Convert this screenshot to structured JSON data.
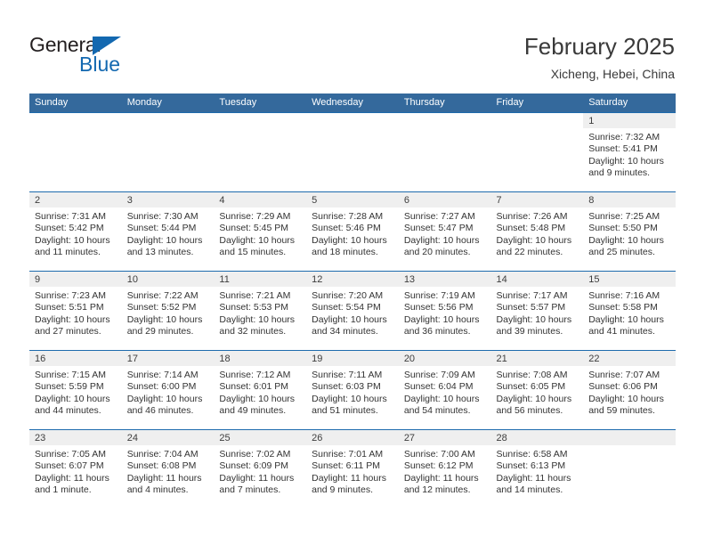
{
  "logo": {
    "word1": "General",
    "word2": "Blue",
    "triangle_color": "#1368b0",
    "text_color": "#231f20"
  },
  "header": {
    "title": "February 2025",
    "subtitle": "Xicheng, Hebei, China"
  },
  "theme": {
    "header_bg": "#34699c",
    "row_divider": "#1e6bad",
    "daynum_band": "#efefef"
  },
  "weekday_headers": [
    "Sunday",
    "Monday",
    "Tuesday",
    "Wednesday",
    "Thursday",
    "Friday",
    "Saturday"
  ],
  "labels": {
    "sunrise": "Sunrise:",
    "sunset": "Sunset:",
    "daylight": "Daylight:"
  },
  "weeks": [
    [
      {
        "day": "",
        "blank": true
      },
      {
        "day": "",
        "blank": true
      },
      {
        "day": "",
        "blank": true
      },
      {
        "day": "",
        "blank": true
      },
      {
        "day": "",
        "blank": true
      },
      {
        "day": "",
        "blank": true
      },
      {
        "day": "1",
        "sunrise": "Sunrise: 7:32 AM",
        "sunset": "Sunset: 5:41 PM",
        "daylight": "Daylight: 10 hours and 9 minutes."
      }
    ],
    [
      {
        "day": "2",
        "sunrise": "Sunrise: 7:31 AM",
        "sunset": "Sunset: 5:42 PM",
        "daylight": "Daylight: 10 hours and 11 minutes."
      },
      {
        "day": "3",
        "sunrise": "Sunrise: 7:30 AM",
        "sunset": "Sunset: 5:44 PM",
        "daylight": "Daylight: 10 hours and 13 minutes."
      },
      {
        "day": "4",
        "sunrise": "Sunrise: 7:29 AM",
        "sunset": "Sunset: 5:45 PM",
        "daylight": "Daylight: 10 hours and 15 minutes."
      },
      {
        "day": "5",
        "sunrise": "Sunrise: 7:28 AM",
        "sunset": "Sunset: 5:46 PM",
        "daylight": "Daylight: 10 hours and 18 minutes."
      },
      {
        "day": "6",
        "sunrise": "Sunrise: 7:27 AM",
        "sunset": "Sunset: 5:47 PM",
        "daylight": "Daylight: 10 hours and 20 minutes."
      },
      {
        "day": "7",
        "sunrise": "Sunrise: 7:26 AM",
        "sunset": "Sunset: 5:48 PM",
        "daylight": "Daylight: 10 hours and 22 minutes."
      },
      {
        "day": "8",
        "sunrise": "Sunrise: 7:25 AM",
        "sunset": "Sunset: 5:50 PM",
        "daylight": "Daylight: 10 hours and 25 minutes."
      }
    ],
    [
      {
        "day": "9",
        "sunrise": "Sunrise: 7:23 AM",
        "sunset": "Sunset: 5:51 PM",
        "daylight": "Daylight: 10 hours and 27 minutes."
      },
      {
        "day": "10",
        "sunrise": "Sunrise: 7:22 AM",
        "sunset": "Sunset: 5:52 PM",
        "daylight": "Daylight: 10 hours and 29 minutes."
      },
      {
        "day": "11",
        "sunrise": "Sunrise: 7:21 AM",
        "sunset": "Sunset: 5:53 PM",
        "daylight": "Daylight: 10 hours and 32 minutes."
      },
      {
        "day": "12",
        "sunrise": "Sunrise: 7:20 AM",
        "sunset": "Sunset: 5:54 PM",
        "daylight": "Daylight: 10 hours and 34 minutes."
      },
      {
        "day": "13",
        "sunrise": "Sunrise: 7:19 AM",
        "sunset": "Sunset: 5:56 PM",
        "daylight": "Daylight: 10 hours and 36 minutes."
      },
      {
        "day": "14",
        "sunrise": "Sunrise: 7:17 AM",
        "sunset": "Sunset: 5:57 PM",
        "daylight": "Daylight: 10 hours and 39 minutes."
      },
      {
        "day": "15",
        "sunrise": "Sunrise: 7:16 AM",
        "sunset": "Sunset: 5:58 PM",
        "daylight": "Daylight: 10 hours and 41 minutes."
      }
    ],
    [
      {
        "day": "16",
        "sunrise": "Sunrise: 7:15 AM",
        "sunset": "Sunset: 5:59 PM",
        "daylight": "Daylight: 10 hours and 44 minutes."
      },
      {
        "day": "17",
        "sunrise": "Sunrise: 7:14 AM",
        "sunset": "Sunset: 6:00 PM",
        "daylight": "Daylight: 10 hours and 46 minutes."
      },
      {
        "day": "18",
        "sunrise": "Sunrise: 7:12 AM",
        "sunset": "Sunset: 6:01 PM",
        "daylight": "Daylight: 10 hours and 49 minutes."
      },
      {
        "day": "19",
        "sunrise": "Sunrise: 7:11 AM",
        "sunset": "Sunset: 6:03 PM",
        "daylight": "Daylight: 10 hours and 51 minutes."
      },
      {
        "day": "20",
        "sunrise": "Sunrise: 7:09 AM",
        "sunset": "Sunset: 6:04 PM",
        "daylight": "Daylight: 10 hours and 54 minutes."
      },
      {
        "day": "21",
        "sunrise": "Sunrise: 7:08 AM",
        "sunset": "Sunset: 6:05 PM",
        "daylight": "Daylight: 10 hours and 56 minutes."
      },
      {
        "day": "22",
        "sunrise": "Sunrise: 7:07 AM",
        "sunset": "Sunset: 6:06 PM",
        "daylight": "Daylight: 10 hours and 59 minutes."
      }
    ],
    [
      {
        "day": "23",
        "sunrise": "Sunrise: 7:05 AM",
        "sunset": "Sunset: 6:07 PM",
        "daylight": "Daylight: 11 hours and 1 minute."
      },
      {
        "day": "24",
        "sunrise": "Sunrise: 7:04 AM",
        "sunset": "Sunset: 6:08 PM",
        "daylight": "Daylight: 11 hours and 4 minutes."
      },
      {
        "day": "25",
        "sunrise": "Sunrise: 7:02 AM",
        "sunset": "Sunset: 6:09 PM",
        "daylight": "Daylight: 11 hours and 7 minutes."
      },
      {
        "day": "26",
        "sunrise": "Sunrise: 7:01 AM",
        "sunset": "Sunset: 6:11 PM",
        "daylight": "Daylight: 11 hours and 9 minutes."
      },
      {
        "day": "27",
        "sunrise": "Sunrise: 7:00 AM",
        "sunset": "Sunset: 6:12 PM",
        "daylight": "Daylight: 11 hours and 12 minutes."
      },
      {
        "day": "28",
        "sunrise": "Sunrise: 6:58 AM",
        "sunset": "Sunset: 6:13 PM",
        "daylight": "Daylight: 11 hours and 14 minutes."
      },
      {
        "day": "",
        "empty": true
      }
    ]
  ]
}
